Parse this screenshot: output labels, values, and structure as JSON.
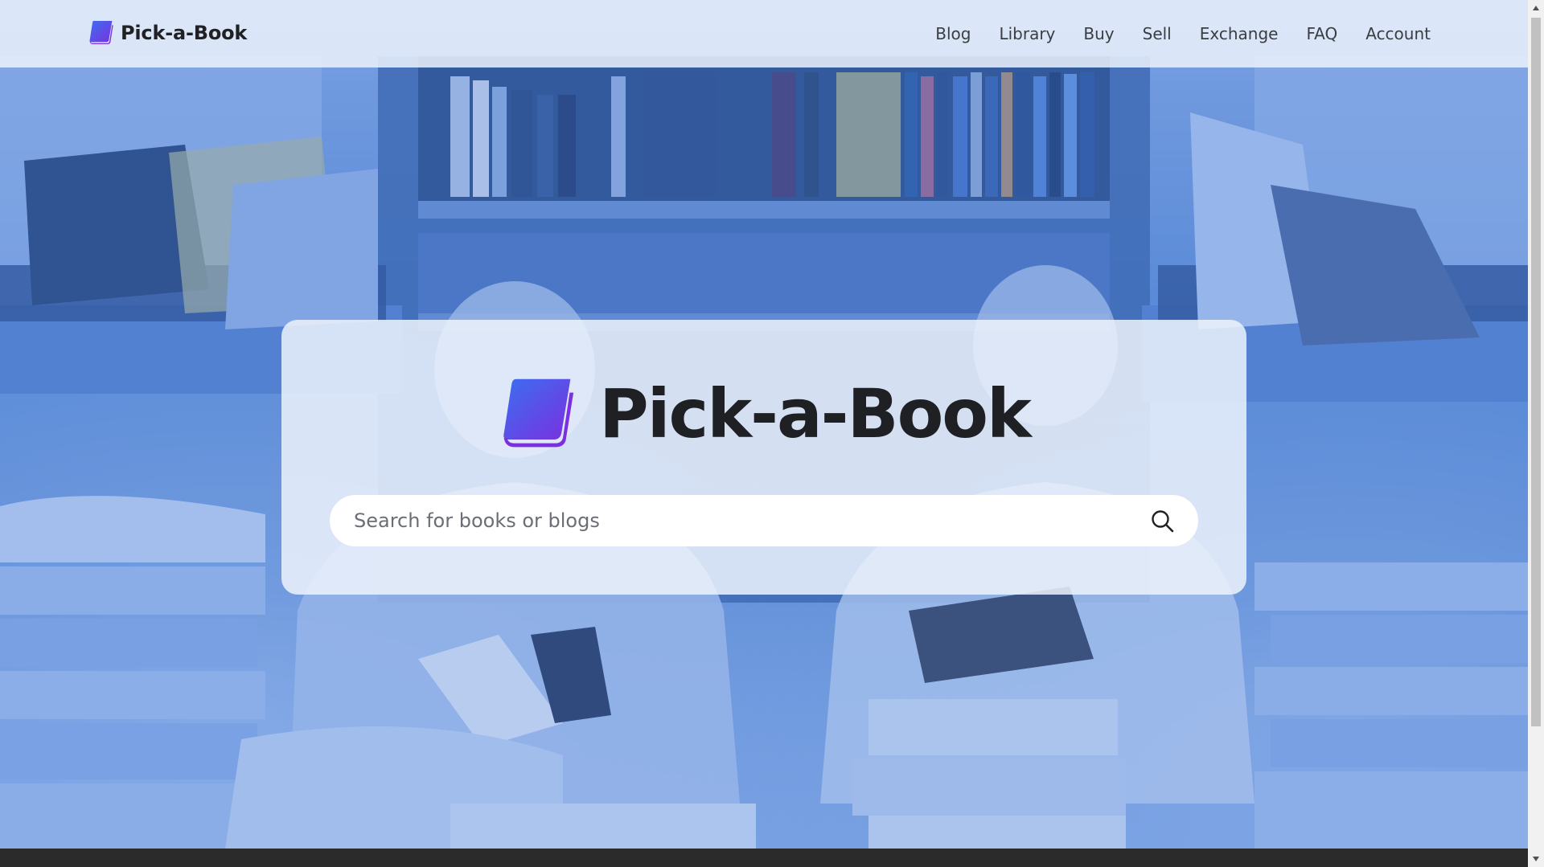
{
  "brand": {
    "name": "Pick-a-Book",
    "icon": "book-icon",
    "icon_color_start": "#3b6ff0",
    "icon_color_end": "#7b2fe0"
  },
  "nav": {
    "items": [
      {
        "label": "Blog"
      },
      {
        "label": "Library"
      },
      {
        "label": "Buy"
      },
      {
        "label": "Sell"
      },
      {
        "label": "Exchange"
      },
      {
        "label": "FAQ"
      },
      {
        "label": "Account"
      }
    ]
  },
  "hero": {
    "title": "Pick-a-Book",
    "background": "library-photo-blue-overlay"
  },
  "search": {
    "placeholder": "Search for books or blogs",
    "value": "",
    "icon": "search-icon"
  },
  "colors": {
    "overlay": "#4278d7",
    "text_dark": "#1e2023"
  }
}
